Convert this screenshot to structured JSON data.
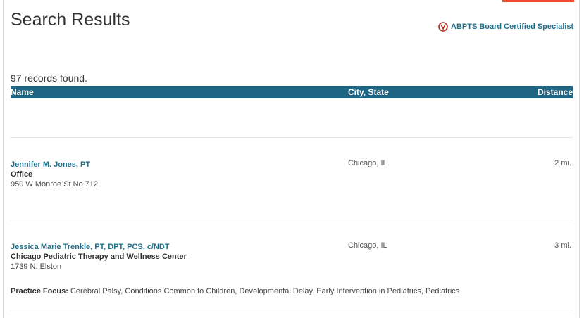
{
  "page": {
    "title": "Search Results",
    "legend_label": "ABPTS Board Certified Specialist",
    "legend_icon": "abpts-badge-icon",
    "accent_color": "#e8532b",
    "header_color": "#1e6583",
    "link_color": "#1f6f8b"
  },
  "results": {
    "count_text": "97 records found.",
    "columns": {
      "name": "Name",
      "city_state": "City, State",
      "distance": "Distance"
    },
    "rows": [
      {
        "name": "Jennifer M. Jones, PT",
        "line2": "Office",
        "address": "950 W Monroe St No 712",
        "city_state": "Chicago, IL",
        "distance": "2 mi."
      },
      {
        "name": "Jessica Marie Trenkle, PT, DPT, PCS, c/NDT",
        "line2": "Chicago Pediatric Therapy and Wellness Center",
        "address": "1739 N. Elston",
        "city_state": "Chicago, IL",
        "distance": "3 mi.",
        "focus_label": "Practice Focus:",
        "focus_value": "Cerebral Palsy, Conditions Common to Children, Developmental Delay, Early Intervention in Pediatrics, Pediatrics"
      }
    ]
  }
}
